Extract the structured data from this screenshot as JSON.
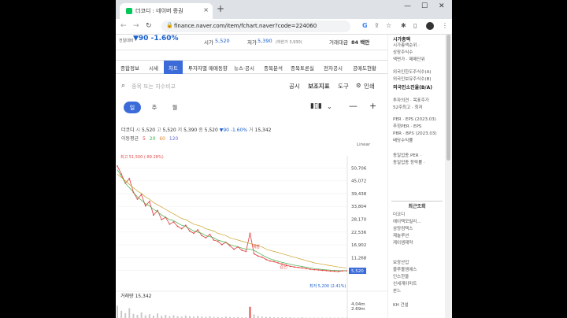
{
  "browser": {
    "tab_title": "더코디 : 네이버 증권",
    "url": "finance.naver.com/item/fchart.naver?code=224060",
    "new_tab": "+",
    "close": "×",
    "win_min": "—",
    "win_max": "☐",
    "win_close": "✕",
    "reload": "C"
  },
  "pricebar": {
    "prev_label": "전일대비",
    "change": "▼90  -1.60%",
    "high_label": "시가",
    "high_value": "5,520",
    "low_label": "저가",
    "low_value": "5,390",
    "low_sub": "(하한가 3,930)",
    "amount_label": "거래대금",
    "amount_value": "84 백만"
  },
  "stock_tabs": [
    "종합정보",
    "시세",
    "차트",
    "투자자별 매매동향",
    "뉴스·공시",
    "종목분석",
    "종목토론실",
    "전자공시",
    "공매도현황"
  ],
  "chart_toolbar": {
    "search_placeholder": "종목 또는 지수비교",
    "notice": "공시",
    "indicator": "보조지표",
    "tools": "도구",
    "print": "인쇄"
  },
  "periods": [
    "일",
    "주",
    "월"
  ],
  "ohlc": {
    "name": "더코디",
    "open_label": "시",
    "open": "5,520",
    "high_label": "고",
    "high": "5,520",
    "low_label": "저",
    "low": "5,390",
    "close_label": "종",
    "close": "5,520",
    "change": "▼90 -1.60%",
    "volume_label": "거",
    "volume": "15,342"
  },
  "ma": {
    "label": "이동평균",
    "p1": "5",
    "p2": "20",
    "p3": "60",
    "p4": "120"
  },
  "chart_meta": {
    "scale": "Linear",
    "high_annot": "최고 51,500 (-89.28%)",
    "low_annot": "최저 5,200 (2.41%)",
    "current": "5,520",
    "buy": "매봉",
    "sell": "감천",
    "volume_title": "거래량",
    "volume_value": "15,342"
  },
  "chart_data": {
    "type": "line",
    "ylim": [
      0,
      56000
    ],
    "yticks": [
      "50,706",
      "45,072",
      "39,438",
      "33,804",
      "28,170",
      "22,536",
      "16,902",
      "11,268",
      "5,634"
    ],
    "ytick_values": [
      50706,
      45072,
      39438,
      33804,
      28170,
      22536,
      16902,
      11268,
      5634
    ],
    "volume_ticks": [
      "4.04m",
      "2.69m"
    ],
    "volume_tick_values": [
      4.04,
      2.69
    ],
    "colors": {
      "price": "#e24b4b",
      "ma_short": "#3fae49",
      "ma_long": "#caa12a",
      "volume": "#c9c9c9"
    },
    "series": [
      {
        "values": [
          51500,
          48000,
          44000,
          46000,
          40000,
          37000,
          39000,
          34000,
          36000,
          30000,
          32000,
          28000,
          29000,
          26000,
          27000,
          25000,
          24000,
          25500,
          23000,
          22000,
          23500,
          21000,
          20000,
          21500,
          19000,
          18500,
          17000,
          18000,
          16500,
          15000,
          16000,
          14500,
          14000,
          22000,
          13000,
          12000,
          11500,
          10500,
          9800,
          9500,
          9000,
          8500,
          8000,
          7500,
          7200,
          7000,
          6800,
          6500,
          6200,
          6000,
          5900,
          5700,
          5600,
          5400,
          5300,
          5200,
          5500,
          5520
        ]
      },
      {
        "values": [
          50000,
          47000,
          44000,
          42000,
          40000,
          38000,
          36500,
          35000,
          34000,
          32500,
          31500,
          30000,
          29000,
          28000,
          27500,
          26500,
          25500,
          25000,
          24000,
          23000,
          22500,
          22000,
          21000,
          20500,
          20000,
          19000,
          18500,
          18000,
          17000,
          16500,
          16000,
          15500,
          15000,
          15000,
          14500,
          13500,
          12500,
          11500,
          10800,
          10200,
          9700,
          9200,
          8800,
          8400,
          8000,
          7700,
          7400,
          7100,
          6800,
          6500,
          6300,
          6100,
          5900,
          5800,
          5700,
          5600,
          5550,
          5500
        ]
      },
      {
        "values": [
          48000,
          46500,
          45000,
          43500,
          42000,
          40500,
          39500,
          38000,
          37000,
          35500,
          34500,
          33500,
          32500,
          31500,
          30500,
          29500,
          28500,
          28000,
          27000,
          26000,
          25500,
          25000,
          24000,
          23500,
          23000,
          22000,
          21500,
          21000,
          20000,
          19500,
          19000,
          18500,
          18000,
          17500,
          17000,
          16500,
          16000,
          15000,
          14500,
          14000,
          13500,
          13000,
          12500,
          12000,
          11500,
          11000,
          10500,
          10000,
          9500,
          9000,
          8700,
          8400,
          8100,
          7800,
          7500,
          7200,
          7000,
          6800
        ]
      }
    ],
    "volume": [
      3.5,
      2.1,
      1.4,
      2.8,
      1.2,
      0.9,
      1.6,
      0.8,
      1.1,
      0.7,
      1.3,
      0.6,
      0.9,
      0.5,
      0.8,
      0.5,
      0.4,
      0.7,
      0.5,
      0.4,
      0.6,
      0.4,
      0.3,
      0.5,
      0.3,
      0.3,
      0.2,
      0.4,
      0.3,
      0.2,
      0.3,
      0.2,
      0.2,
      3.2,
      1.0,
      0.6,
      0.4,
      0.3,
      0.3,
      0.2,
      0.2,
      0.2,
      0.2,
      0.2,
      0.1,
      0.1,
      0.2,
      0.1,
      0.1,
      0.1,
      0.1,
      0.1,
      0.1,
      0.1,
      0.1,
      0.1,
      0.1,
      0.1
    ]
  },
  "right_panel": {
    "s1_title": "시가총액",
    "s1_lines": [
      "시가총액순위 ·",
      "상장주식수",
      "액면가 · 매매단위"
    ],
    "s2_lines": [
      "외국인한도주식수(A)",
      "외국인보유주식수(B)"
    ],
    "s2_bold": "외국인소진율(B/A)",
    "s3_lines": [
      "투자의견 · 목표주가",
      "52주최고 · 최저"
    ],
    "s4_lines": [
      "PER · EPS (2023.03)",
      "추정PER · EPS",
      "PBR · BPS (2023.03)",
      "배당수익률"
    ],
    "s5_lines": [
      "동일업종 PER ·",
      "동일업종 등락률 ·"
    ],
    "recent_title": "최근조회",
    "recent": [
      "더코디",
      "에이텍모빌리...",
      "삼양컴텍스",
      "제놀루션",
      "케이엠제약"
    ],
    "s7_lines": [
      "보광산업",
      "블루몰엠에스",
      "인스한울",
      "신세계이마트",
      "본느"
    ],
    "s8": "KH 건설"
  }
}
